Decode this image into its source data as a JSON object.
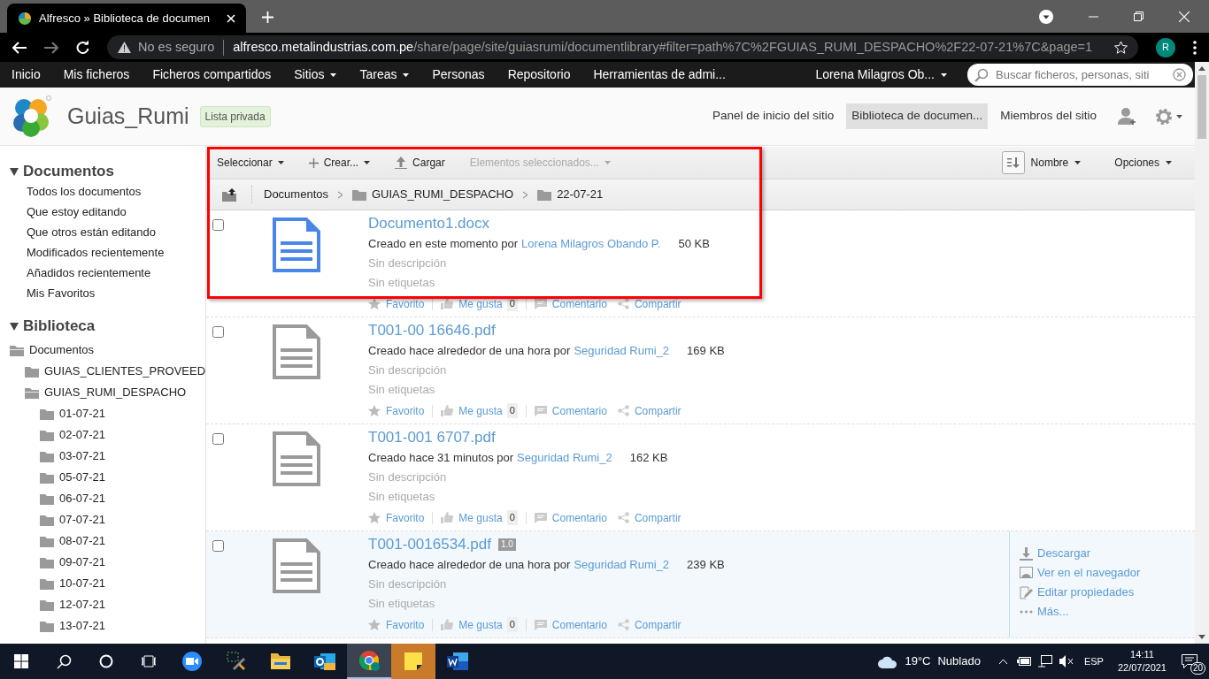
{
  "browser": {
    "tab_title": "Alfresco » Biblioteca de documen",
    "security": "No es seguro",
    "url_host": "alfresco.metalindustrias.com.pe",
    "url_path": "/share/page/site/guiasrumi/documentlibrary#filter=path%7C%2FGUIAS_RUMI_DESPACHO%2F22-07-21%7C&page=1",
    "profile": "R"
  },
  "nav": {
    "items": [
      {
        "label": "Inicio",
        "dropdown": false
      },
      {
        "label": "Mis ficheros",
        "dropdown": false
      },
      {
        "label": "Ficheros compartidos",
        "dropdown": false
      },
      {
        "label": "Sitios",
        "dropdown": true
      },
      {
        "label": "Tareas",
        "dropdown": true
      },
      {
        "label": "Personas",
        "dropdown": false
      },
      {
        "label": "Repositorio",
        "dropdown": false
      },
      {
        "label": "Herramientas de admi...",
        "dropdown": false
      }
    ],
    "user": "Lorena Milagros Ob...",
    "search_placeholder": "Buscar ficheros, personas, siti"
  },
  "site": {
    "title": "Guias_Rumi",
    "visibility": "Lista privada",
    "links": [
      {
        "label": "Panel de inicio del sitio",
        "selected": false
      },
      {
        "label": "Biblioteca de documen...",
        "selected": true
      },
      {
        "label": "Miembros del sitio",
        "selected": false
      }
    ]
  },
  "sidebar": {
    "filters": {
      "title": "Documentos",
      "expanded": true,
      "items": [
        "Todos los documentos",
        "Que estoy editando",
        "Que otros están editando",
        "Modificados recientemente",
        "Añadidos recientemente",
        "Mis Favoritos"
      ]
    },
    "library": {
      "title": "Biblioteca",
      "expanded": true,
      "tree": [
        {
          "label": "Documentos",
          "expanded": true,
          "children": [
            {
              "label": "GUIAS_CLIENTES_PROVEED",
              "expanded": false
            },
            {
              "label": "GUIAS_RUMI_DESPACHO",
              "expanded": true,
              "children": [
                {
                  "label": "01-07-21",
                  "expanded": false
                },
                {
                  "label": "02-07-21",
                  "expanded": false
                },
                {
                  "label": "03-07-21",
                  "expanded": false
                },
                {
                  "label": "05-07-21",
                  "expanded": false
                },
                {
                  "label": "06-07-21",
                  "expanded": false
                },
                {
                  "label": "07-07-21",
                  "expanded": false
                },
                {
                  "label": "08-07-21",
                  "expanded": false
                },
                {
                  "label": "09-07-21",
                  "expanded": false
                },
                {
                  "label": "10-07-21",
                  "expanded": false
                },
                {
                  "label": "12-07-21",
                  "expanded": false
                },
                {
                  "label": "13-07-21",
                  "expanded": false
                }
              ]
            }
          ]
        }
      ]
    }
  },
  "toolbar": {
    "actions": [
      {
        "label": "Seleccionar",
        "kind": "menu",
        "disabled": false
      },
      {
        "label": "Crear...",
        "kind": "create",
        "disabled": false
      },
      {
        "label": "Cargar",
        "kind": "upload",
        "disabled": false
      },
      {
        "label": "Elementos seleccionados...",
        "kind": "menu",
        "disabled": true
      }
    ],
    "sort": "Nombre",
    "options": "Opciones"
  },
  "breadcrumb": [
    "Documentos",
    "GUIAS_RUMI_DESPACHO",
    "22-07-21"
  ],
  "documents": [
    {
      "name": "Documento1.docx",
      "kind": "word",
      "created": "Creado en este momento por",
      "author": "Lorena Milagros Obando P.",
      "size": "50 KB",
      "description": "Sin descripción",
      "tags": "Sin etiquetas",
      "favorite": "Favorito",
      "like": "Me gusta",
      "likes": "0",
      "comment": "Comentario",
      "share": "Compartir",
      "checked": false,
      "hovered": false
    },
    {
      "name": "T001-00 16646.pdf",
      "kind": "pdf",
      "created": "Creado hace alrededor de una hora por",
      "author": "Seguridad Rumi_2",
      "size": "169 KB",
      "description": "Sin descripción",
      "tags": "Sin etiquetas",
      "favorite": "Favorito",
      "like": "Me gusta",
      "likes": "0",
      "comment": "Comentario",
      "share": "Compartir",
      "checked": false,
      "hovered": false
    },
    {
      "name": "T001-001 6707.pdf",
      "kind": "pdf",
      "created": "Creado hace 31 minutos por",
      "author": "Seguridad Rumi_2",
      "size": "162 KB",
      "description": "Sin descripción",
      "tags": "Sin etiquetas",
      "favorite": "Favorito",
      "like": "Me gusta",
      "likes": "0",
      "comment": "Comentario",
      "share": "Compartir",
      "checked": false,
      "hovered": false
    },
    {
      "name": "T001-0016534.pdf",
      "version": "1.0",
      "kind": "pdf",
      "created": "Creado hace alrededor de una hora por",
      "author": "Seguridad Rumi_2",
      "size": "239 KB",
      "description": "Sin descripción",
      "tags": "Sin etiquetas",
      "favorite": "Favorito",
      "like": "Me gusta",
      "likes": "0",
      "comment": "Comentario",
      "share": "Compartir",
      "checked": false,
      "hovered": true,
      "actions": [
        {
          "label": "Descargar",
          "kind": "download"
        },
        {
          "label": "Ver en el navegador",
          "kind": "view"
        },
        {
          "label": "Editar propiedades",
          "kind": "edit"
        },
        {
          "label": "Más...",
          "kind": "more"
        }
      ]
    }
  ],
  "taskbar": {
    "apps": [
      {
        "kind": "zoom",
        "active": false,
        "flashing": false
      },
      {
        "kind": "tools",
        "active": false,
        "flashing": false
      },
      {
        "kind": "explorer",
        "active": false,
        "flashing": false
      },
      {
        "kind": "outlook",
        "active": false,
        "flashing": false
      },
      {
        "kind": "chrome",
        "active": true,
        "flashing": false
      },
      {
        "kind": "notes",
        "active": false,
        "flashing": true
      },
      {
        "kind": "word",
        "active": false,
        "flashing": false
      }
    ],
    "temperature": "19°C",
    "weather": "Nublado",
    "language": "ESP",
    "time": "14:11",
    "date": "22/07/2021",
    "notifications": "20"
  }
}
